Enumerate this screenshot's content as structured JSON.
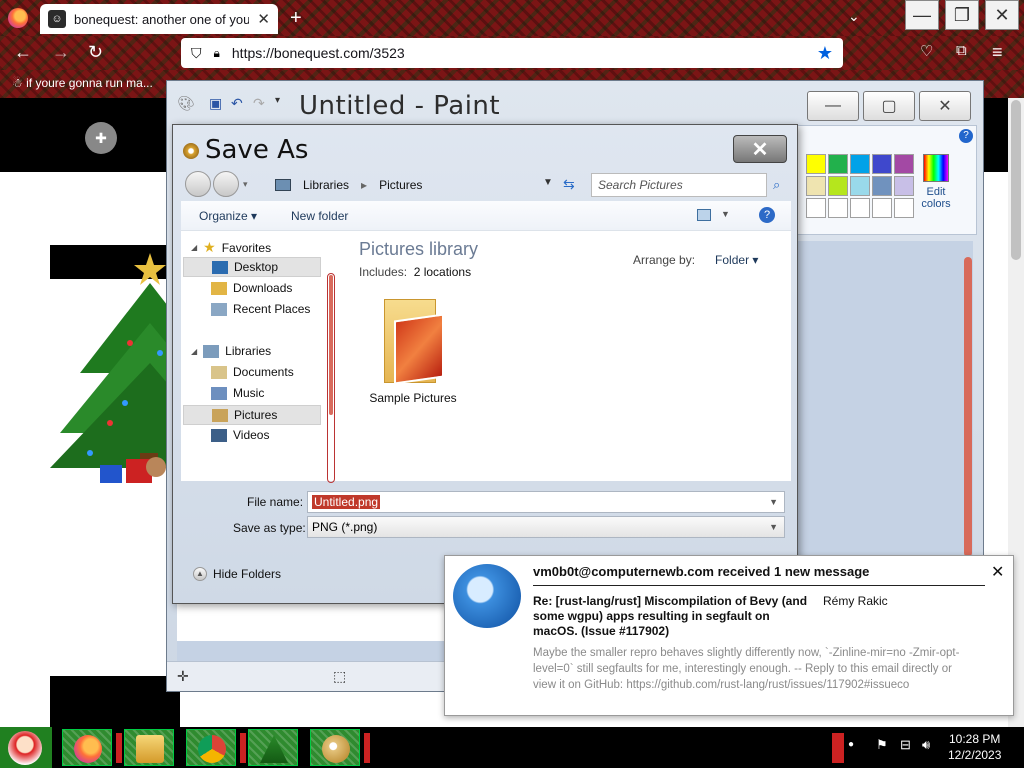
{
  "browser": {
    "tab_title": "bonequest: another one of your tr",
    "url": "https://bonequest.com/3523",
    "bookmark": "if youre gonna run ma..."
  },
  "paint": {
    "title": "Untitled - Paint",
    "edit_colors": "Edit colors",
    "palette": [
      "#ffff00",
      "#22b14c",
      "#00a2e8",
      "#3f48cc",
      "#a349a4",
      "#efe4b0",
      "#b5e61d",
      "#99d9ea",
      "#7092be",
      "#c8bfe7",
      "#ffffff",
      "#ffffff",
      "#ffffff",
      "#ffffff",
      "#ffffff"
    ]
  },
  "dialog": {
    "title": "Save As",
    "breadcrumb": [
      "Libraries",
      "Pictures"
    ],
    "search_placeholder": "Search Pictures",
    "organize": "Organize",
    "new_folder": "New folder",
    "nav": {
      "favorites": "Favorites",
      "desktop": "Desktop",
      "downloads": "Downloads",
      "recent": "Recent Places",
      "libraries": "Libraries",
      "documents": "Documents",
      "music": "Music",
      "pictures": "Pictures",
      "videos": "Videos"
    },
    "library_title": "Pictures library",
    "includes_label": "Includes:",
    "includes_value": "2 locations",
    "arrange_label": "Arrange by:",
    "arrange_value": "Folder",
    "folder_name": "Sample Pictures",
    "file_name_label": "File name:",
    "file_name_value": "Untitled.png",
    "save_type_label": "Save as type:",
    "save_type_value": "PNG (*.png)",
    "hide_folders": "Hide Folders"
  },
  "notification": {
    "header": "vm0b0t@computernewb.com received 1 new message",
    "subject": "Re: [rust-lang/rust] Miscompilation of Bevy (and some wgpu) apps resulting in segfault on macOS. (Issue #117902)",
    "from": "Rémy Rakic",
    "body": "Maybe the smaller repro behaves slightly differently now, `-Zinline-mir=no -Zmir-opt-level=0` still segfaults for me, interestingly enough. -- Reply to this email directly or view it on GitHub: https://github.com/rust-lang/rust/issues/117902#issueco"
  },
  "taskbar": {
    "time": "10:28 PM",
    "date": "12/2/2023"
  }
}
